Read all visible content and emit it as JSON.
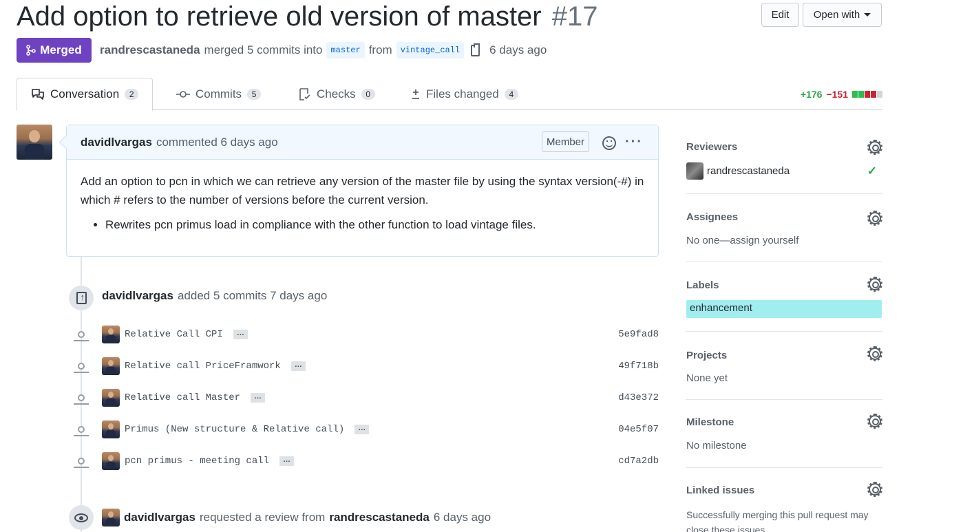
{
  "header": {
    "title": "Add option to retrieve old version of master",
    "number": "#17",
    "edit_label": "Edit",
    "open_with_label": "Open with"
  },
  "state": {
    "label": "Merged",
    "author": "randrescastaneda",
    "action": "merged 5 commits into",
    "base_branch": "master",
    "from_word": "from",
    "head_branch": "vintage_call",
    "time": "6 days ago"
  },
  "tabs": [
    {
      "label": "Conversation",
      "count": "2"
    },
    {
      "label": "Commits",
      "count": "5"
    },
    {
      "label": "Checks",
      "count": "0"
    },
    {
      "label": "Files changed",
      "count": "4"
    }
  ],
  "diffstat": {
    "additions": "+176",
    "deletions": "−151"
  },
  "comment": {
    "author": "davidlvargas",
    "meta": "commented 6 days ago",
    "role": "Member",
    "body": "Add an option to pcn in which we can retrieve any version of the master file by using the syntax version(-#) in which # refers to the number of versions before the current version.",
    "bullet": "Rewrites pcn primus load in compliance with the other function to load vintage files."
  },
  "commit_event": {
    "author": "davidlvargas",
    "text": "added 5 commits 7 days ago"
  },
  "commits": [
    {
      "message": "Relative Call CPI",
      "sha": "5e9fad8"
    },
    {
      "message": "Relative call PriceFramwork",
      "sha": "49f718b"
    },
    {
      "message": "Relative call Master",
      "sha": "d43e372"
    },
    {
      "message": "Primus (New structure & Relative call)",
      "sha": "04e5f07"
    },
    {
      "message": "pcn primus - meeting call",
      "sha": "cd7a2db"
    }
  ],
  "review_event": {
    "author": "davidlvargas",
    "text": "requested a review from",
    "reviewer": "randrescastaneda",
    "time": "6 days ago"
  },
  "sidebar": {
    "reviewers_title": "Reviewers",
    "reviewer_name": "randrescastaneda",
    "assignees_title": "Assignees",
    "assignees_value": "No one—assign yourself",
    "labels_title": "Labels",
    "label_name": "enhancement",
    "projects_title": "Projects",
    "projects_value": "None yet",
    "milestone_title": "Milestone",
    "milestone_value": "No milestone",
    "linked_title": "Linked issues",
    "linked_value": "Successfully merging this pull request may close these issues."
  },
  "colors": {
    "merged": "#6f42c1",
    "additions": "#28a745",
    "deletions": "#cb2431",
    "label": "#a2eeef"
  }
}
